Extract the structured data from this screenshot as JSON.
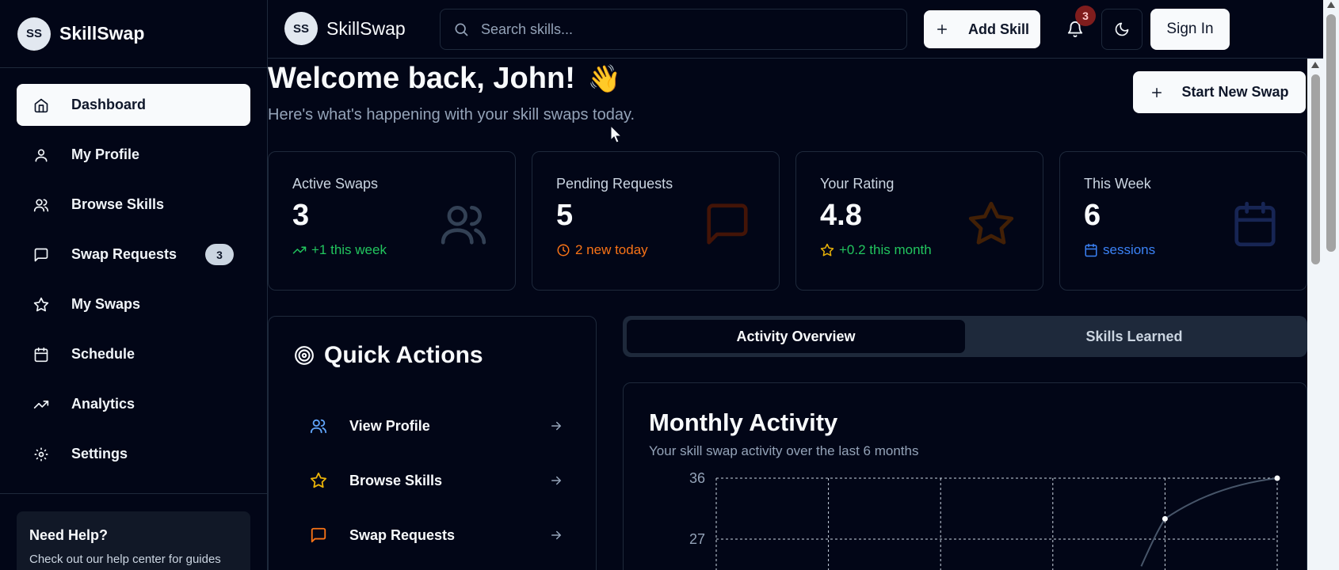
{
  "brand": {
    "initials": "SS",
    "name": "SkillSwap"
  },
  "sidebar": {
    "items": [
      {
        "label": "Dashboard",
        "icon": "home-icon",
        "active": true
      },
      {
        "label": "My Profile",
        "icon": "user-icon"
      },
      {
        "label": "Browse Skills",
        "icon": "users-icon"
      },
      {
        "label": "Swap Requests",
        "icon": "message-icon",
        "badge": "3"
      },
      {
        "label": "My Swaps",
        "icon": "star-icon"
      },
      {
        "label": "Schedule",
        "icon": "calendar-icon"
      },
      {
        "label": "Analytics",
        "icon": "trending-up-icon"
      },
      {
        "label": "Settings",
        "icon": "gear-icon"
      }
    ],
    "help": {
      "title": "Need Help?",
      "text": "Check out our help center for guides and"
    }
  },
  "topbar": {
    "search_placeholder": "Search skills...",
    "add_skill_label": "Add Skill",
    "notification_count": "3",
    "sign_in_label": "Sign In"
  },
  "main": {
    "welcome": "Welcome back, John!",
    "wave": "👋",
    "subtitle": "Here's what's happening with your skill swaps today.",
    "start_swap_label": "Start New Swap",
    "stats": [
      {
        "label": "Active Swaps",
        "value": "3",
        "trend": "+1 this week",
        "trend_color": "#22c55e",
        "icon": "users-icon",
        "icon_color": "#334155"
      },
      {
        "label": "Pending Requests",
        "value": "5",
        "trend": "2 new today",
        "trend_color": "#f97316",
        "icon": "message-icon",
        "icon_color": "#431407"
      },
      {
        "label": "Your Rating",
        "value": "4.8",
        "trend": "+0.2 this month",
        "trend_color": "#22c55e",
        "trend_icon_color": "#eab308",
        "icon": "star-icon",
        "icon_color": "#422006"
      },
      {
        "label": "This Week",
        "value": "6",
        "trend": "sessions",
        "trend_color": "#3b82f6",
        "icon": "calendar-icon",
        "icon_color": "#172554"
      }
    ],
    "quick_actions": {
      "title": "Quick Actions",
      "items": [
        {
          "label": "View Profile",
          "icon": "users-icon",
          "color": "#60a5fa"
        },
        {
          "label": "Browse Skills",
          "icon": "star-icon",
          "color": "#eab308"
        },
        {
          "label": "Swap Requests",
          "icon": "message-icon",
          "color": "#f97316"
        }
      ]
    },
    "tabs": [
      {
        "label": "Activity Overview",
        "active": true
      },
      {
        "label": "Skills Learned",
        "active": false
      }
    ],
    "chart": {
      "title": "Monthly Activity",
      "description": "Your skill swap activity over the last 6 months"
    }
  },
  "chart_data": {
    "type": "line",
    "title": "Monthly Activity",
    "yticks": [
      27,
      36
    ],
    "ylim": [
      18,
      36
    ],
    "series": [
      {
        "values": [
          null,
          null,
          null,
          null,
          30,
          36
        ]
      }
    ],
    "grid": true
  }
}
